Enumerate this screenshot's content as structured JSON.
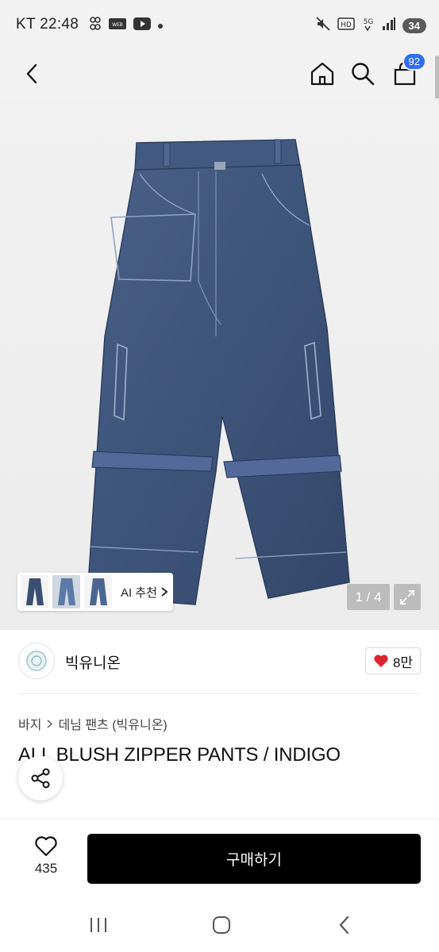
{
  "status_bar": {
    "carrier_time": "KT 22:48",
    "battery": "34",
    "hd_label": "HD",
    "network_label": "5G"
  },
  "header": {
    "cart_count": "92"
  },
  "gallery": {
    "ai_recommend_label": "AI 추천",
    "image_counter": "1 / 4"
  },
  "brand": {
    "name": "빅유니온",
    "like_count": "8만"
  },
  "breadcrumb": {
    "items": [
      "바지",
      "데님 팬츠 (빅유니온)"
    ]
  },
  "product": {
    "title": "ALL BLUSH ZIPPER PANTS / INDIGO"
  },
  "buy_bar": {
    "wish_count": "435",
    "buy_label": "구매하기"
  },
  "colors": {
    "accent_blue": "#2f6ff0",
    "like_red": "#e0242f",
    "denim": "#3d5479"
  }
}
